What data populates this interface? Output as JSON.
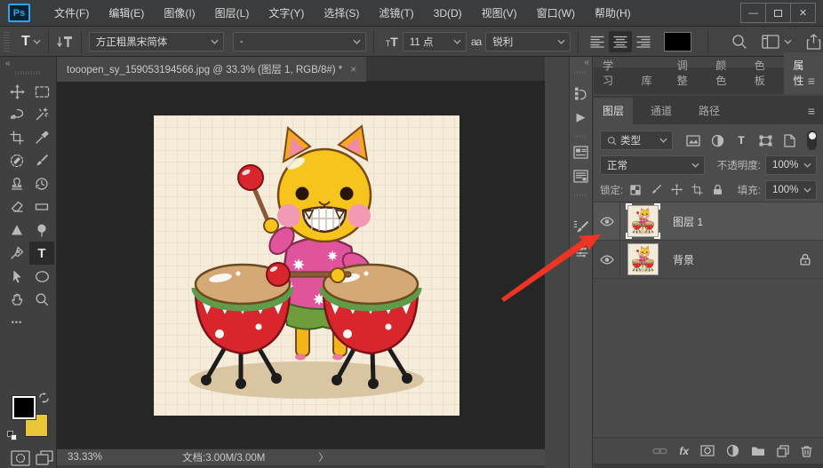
{
  "app": {
    "logo_text": "Ps"
  },
  "menu_bar": {
    "items": [
      "文件(F)",
      "编辑(E)",
      "图像(I)",
      "图层(L)",
      "文字(Y)",
      "选择(S)",
      "滤镜(T)",
      "3D(D)",
      "视图(V)",
      "窗口(W)",
      "帮助(H)"
    ]
  },
  "options_bar": {
    "tool_letter": "T",
    "font_family_value": "方正粗黑宋简体",
    "font_style_value": "-",
    "font_size_value": "11 点",
    "anti_alias_value": "锐利"
  },
  "document": {
    "tab_title": "tooopen_sy_159053194566.jpg @ 33.3% (图层 1, RGB/8#) *",
    "zoom_level": "33.33%",
    "doc_sizes": "文档:3.00M/3.00M"
  },
  "toolbar": {
    "tools": [
      "move",
      "rectangular-marquee",
      "lasso",
      "quick-selection",
      "crop",
      "eyedropper",
      "spot-healing-brush",
      "brush",
      "clone-stamp",
      "history-brush",
      "eraser",
      "gradient",
      "sharpen",
      "dodge",
      "pen",
      "type",
      "path-selection",
      "ellipse-shape",
      "hand",
      "zoom"
    ],
    "selected_tool": "type",
    "foreground_color": "#000000",
    "background_color": "#e9c636"
  },
  "panels": {
    "tabs_main": [
      "学习",
      "库",
      "调整",
      "颜色",
      "色板",
      "属性"
    ],
    "active_main_tab": "属性",
    "tabs_group2": [
      "图层",
      "通道",
      "路径"
    ],
    "active_group2_tab": "图层",
    "layers_panel": {
      "filter_type_value": "类型",
      "blend_mode_value": "正常",
      "opacity_label": "不透明度:",
      "opacity_value": "100%",
      "lock_label": "锁定:",
      "fill_label": "填充:",
      "fill_value": "100%",
      "rows": [
        {
          "name": "图层 1",
          "selected": true,
          "locked": false,
          "visible": true
        },
        {
          "name": "背景",
          "selected": false,
          "locked": true,
          "visible": true
        }
      ]
    }
  },
  "icons": {
    "minimize": "—",
    "close": "✕",
    "tab_close": "×",
    "collapse_left": "«",
    "expand_right": "»",
    "menu": "≡",
    "ellipsis": "•••",
    "play": "▶",
    "chevron_right": "〉",
    "t_small": "T",
    "t_big": "T",
    "aa": "aa",
    "fx": "fx"
  },
  "colors": {
    "annotation_arrow": "#ee3524",
    "accent_blue": "#2da5f3",
    "background_swatch": "#e9c636",
    "panel_bg": "#474747",
    "canvas_bg": "#262626"
  }
}
